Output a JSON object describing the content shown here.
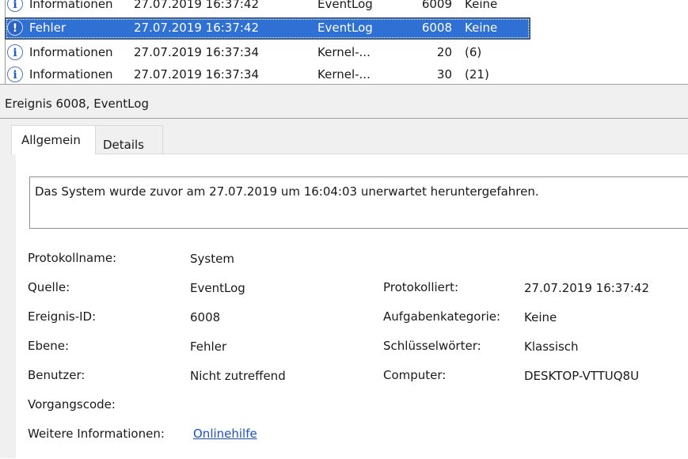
{
  "events": [
    {
      "level": "Informationen",
      "date": "27.07.2019 16:37:42",
      "source": "EventLog",
      "id": "6009",
      "category": "Keine",
      "icon": "info-icon",
      "selected": false
    },
    {
      "level": "Fehler",
      "date": "27.07.2019 16:37:42",
      "source": "EventLog",
      "id": "6008",
      "category": "Keine",
      "icon": "error-icon",
      "selected": true
    },
    {
      "level": "Informationen",
      "date": "27.07.2019 16:37:34",
      "source": "Kernel-...",
      "id": "20",
      "category": "(6)",
      "icon": "info-icon",
      "selected": false
    },
    {
      "level": "Informationen",
      "date": "27.07.2019 16:37:34",
      "source": "Kernel-...",
      "id": "30",
      "category": "(21)",
      "icon": "info-icon",
      "selected": false
    }
  ],
  "panel": {
    "title": "Ereignis 6008, EventLog",
    "tabs": {
      "general": "Allgemein",
      "details": "Details"
    },
    "message": "Das System wurde zuvor am 27.07.2019 um 16:04:03 unerwartet heruntergefahren.",
    "fields": {
      "protokollname_label": "Protokollname:",
      "protokollname_value": "System",
      "quelle_label": "Quelle:",
      "quelle_value": "EventLog",
      "ereignis_label": "Ereignis-ID:",
      "ereignis_value": "6008",
      "ebene_label": "Ebene:",
      "ebene_value": "Fehler",
      "benutzer_label": "Benutzer:",
      "benutzer_value": "Nicht zutreffend",
      "vorgang_label": "Vorgangscode:",
      "weitere_label": "Weitere Informationen:",
      "weitere_link": "Onlinehilfe",
      "protokolliert_label": "Protokolliert:",
      "protokolliert_value": "27.07.2019 16:37:42",
      "aufgabe_label": "Aufgabenkategorie:",
      "aufgabe_value": "Keine",
      "schluessel_label": "Schlüsselwörter:",
      "schluessel_value": "Klassisch",
      "computer_label": "Computer:",
      "computer_value": "DESKTOP-VTTUQ8U"
    }
  },
  "colors": {
    "selection": "#2e70d3",
    "link": "#1a4fd6",
    "panel_bg": "#f0f0f0"
  }
}
